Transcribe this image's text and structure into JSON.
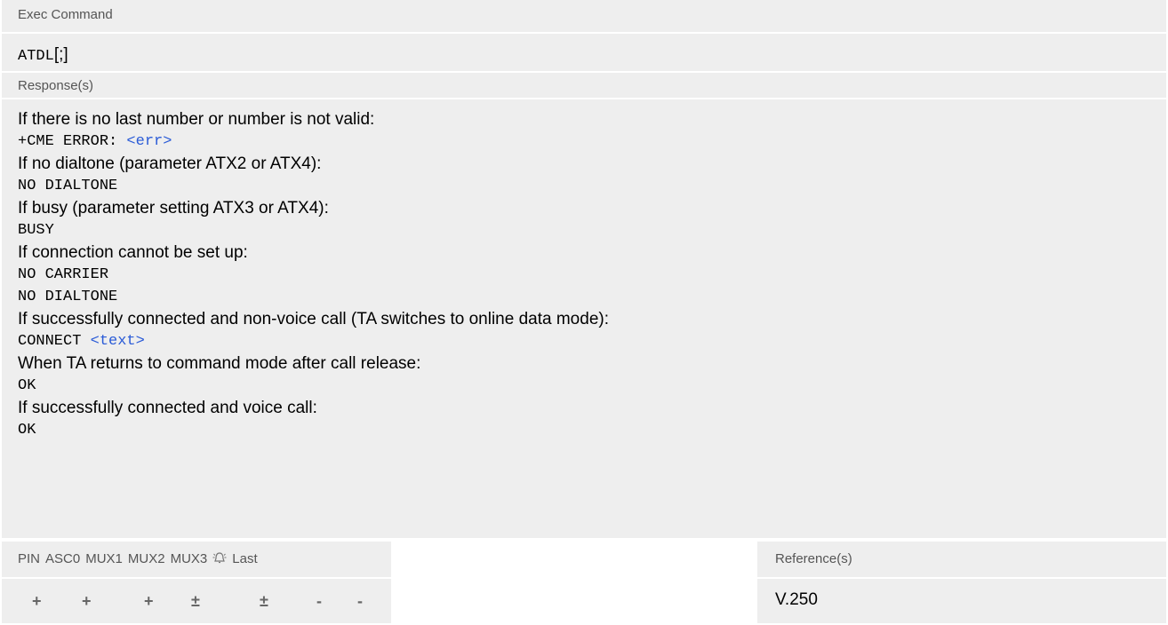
{
  "exec": {
    "label": "Exec Command",
    "syntax_cmd": "ATDL",
    "syntax_opt": "[;]"
  },
  "response": {
    "label": "Response(s)",
    "lines": [
      {
        "type": "text",
        "text": "If there is no last number or number is not valid:"
      },
      {
        "type": "code",
        "text": "+CME ERROR: ",
        "link": "<err>"
      },
      {
        "type": "text",
        "text": "If no dialtone (parameter ATX2 or ATX4):"
      },
      {
        "type": "code",
        "text": "NO DIALTONE"
      },
      {
        "type": "text",
        "text": "If busy (parameter setting ATX3 or ATX4):"
      },
      {
        "type": "code",
        "text": "BUSY"
      },
      {
        "type": "text",
        "text": "If connection cannot be set up:"
      },
      {
        "type": "code",
        "text": "NO CARRIER"
      },
      {
        "type": "code",
        "text": "NO DIALTONE"
      },
      {
        "type": "text",
        "text": "If successfully connected and non-voice call (TA switches to online data mode):"
      },
      {
        "type": "code",
        "text": "CONNECT ",
        "link": "<text>"
      },
      {
        "type": "text",
        "text": "When TA returns to command mode after call release:"
      },
      {
        "type": "code",
        "text": "OK"
      },
      {
        "type": "text",
        "text": "If successfully connected and voice call:"
      },
      {
        "type": "code",
        "text": "OK"
      }
    ]
  },
  "pin_table": {
    "headers": [
      "PIN",
      "ASC0",
      "MUX1",
      "MUX2",
      "MUX3",
      "",
      "Last"
    ],
    "values": [
      "+",
      "+",
      "+",
      "±",
      "±",
      "-",
      "-"
    ]
  },
  "reference": {
    "label": "Reference(s)",
    "value": "V.250"
  }
}
